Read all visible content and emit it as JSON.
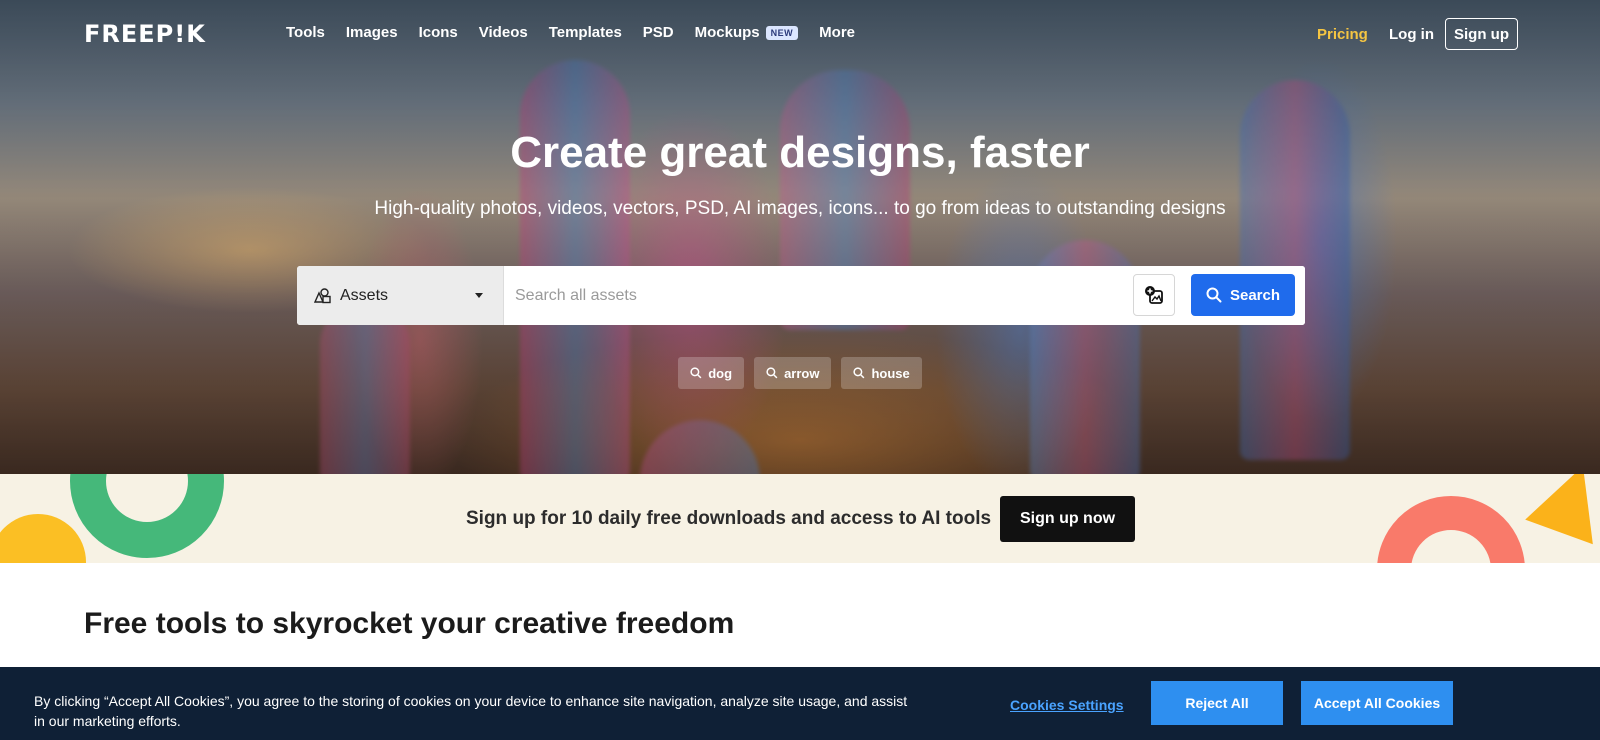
{
  "header": {
    "logo": "FREEP!K",
    "nav": [
      {
        "label": "Tools"
      },
      {
        "label": "Images"
      },
      {
        "label": "Icons"
      },
      {
        "label": "Videos"
      },
      {
        "label": "Templates"
      },
      {
        "label": "PSD"
      },
      {
        "label": "Mockups",
        "badge": "NEW"
      },
      {
        "label": "More"
      }
    ],
    "pricing": "Pricing",
    "login": "Log in",
    "signup": "Sign up"
  },
  "hero": {
    "title": "Create great designs, faster",
    "subtitle": "High-quality photos, videos, vectors, PSD, AI images, icons... to go from ideas to outstanding designs"
  },
  "search": {
    "category": "Assets",
    "placeholder": "Search all assets",
    "button": "Search",
    "icons": {
      "category": "shapes-icon",
      "image_search": "image-search-icon",
      "button": "search-icon"
    }
  },
  "suggestions": [
    "dog",
    "arrow",
    "house"
  ],
  "promo": {
    "text": "Sign up for 10 daily free downloads and access to AI tools",
    "button": "Sign up now"
  },
  "section": {
    "title": "Free tools to skyrocket your creative freedom"
  },
  "cookie": {
    "text": "By clicking “Accept All Cookies”, you agree to the storing of cookies on your device to enhance site navigation, analyze site usage, and assist in our marketing efforts.",
    "settings": "Cookies Settings",
    "reject": "Reject All",
    "accept": "Accept All Cookies"
  },
  "colors": {
    "accent": "#1f6bec",
    "pricing": "#f5c542",
    "promo_bg": "#f7f2e4",
    "cookie_bg": "#0f2036",
    "cookie_button": "#2e8ff0"
  }
}
